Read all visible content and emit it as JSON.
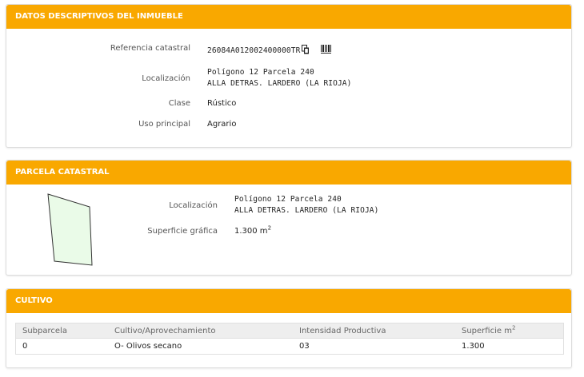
{
  "descriptivos": {
    "title": "DATOS DESCRIPTIVOS DEL INMUEBLE",
    "ref_label": "Referencia catastral",
    "ref_value": "26084A012002400000TR",
    "loc_label": "Localización",
    "loc_line1": "Polígono 12 Parcela 240",
    "loc_line2": "ALLA DETRAS. LARDERO (LA RIOJA)",
    "clase_label": "Clase",
    "clase_value": "Rústico",
    "uso_label": "Uso principal",
    "uso_value": "Agrario",
    "icons": [
      "copy-icon",
      "barcode-icon"
    ]
  },
  "parcela": {
    "title": "PARCELA CATASTRAL",
    "loc_label": "Localización",
    "loc_line1": "Polígono 12 Parcela 240",
    "loc_line2": "ALLA DETRAS. LARDERO (LA RIOJA)",
    "sup_label": "Superficie gráfica",
    "sup_value": "1.300 m",
    "sup_unit_exp": "2",
    "shape_fill": "#eafbe8",
    "shape_stroke": "#333333"
  },
  "cultivo": {
    "title": "CULTIVO",
    "columns": [
      "Subparcela",
      "Cultivo/Aprovechamiento",
      "Intensidad Productiva",
      "Superficie m"
    ],
    "column_exp": "2",
    "rows": [
      {
        "subparcela": "0",
        "cultivo": "O- Olivos secano",
        "intensidad": "03",
        "superficie": "1.300"
      }
    ]
  },
  "colors": {
    "header_bg": "#f9a800",
    "table_header_bg": "#eeeeee"
  }
}
